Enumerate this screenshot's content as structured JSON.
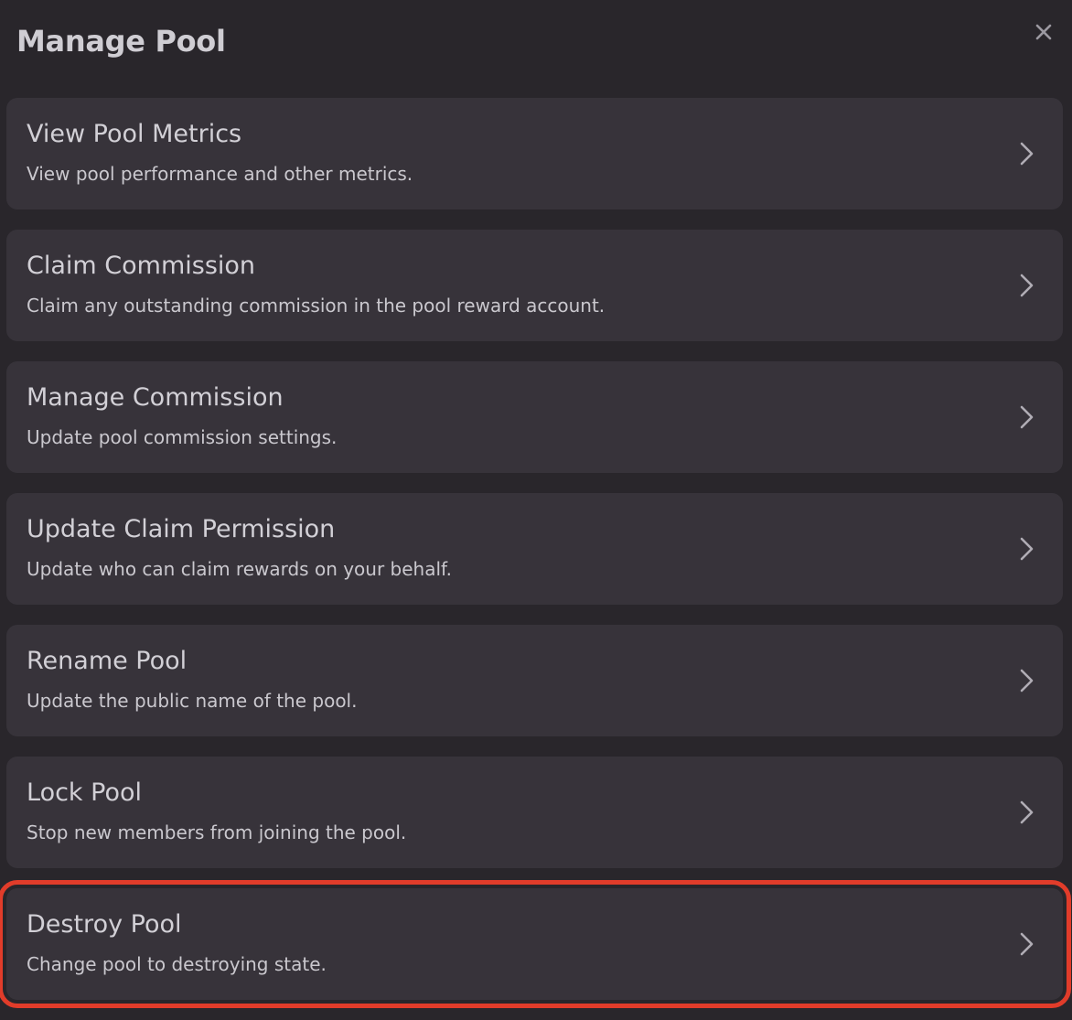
{
  "modal": {
    "title": "Manage Pool",
    "close_icon": "close-icon"
  },
  "items": [
    {
      "title": "View Pool Metrics",
      "description": "View pool performance and other metrics."
    },
    {
      "title": "Claim Commission",
      "description": "Claim any outstanding commission in the pool reward account."
    },
    {
      "title": "Manage Commission",
      "description": "Update pool commission settings."
    },
    {
      "title": "Update Claim Permission",
      "description": "Update who can claim rewards on your behalf."
    },
    {
      "title": "Rename Pool",
      "description": "Update the public name of the pool."
    },
    {
      "title": "Lock Pool",
      "description": "Stop new members from joining the pool."
    },
    {
      "title": "Destroy Pool",
      "description": "Change pool to destroying state."
    }
  ],
  "icons": {
    "item_arrow": "chevron-right-icon"
  },
  "colors": {
    "background": "#29262b",
    "card": "#37333a",
    "text": "#d2d0d6",
    "highlight": "#e13c2a"
  }
}
